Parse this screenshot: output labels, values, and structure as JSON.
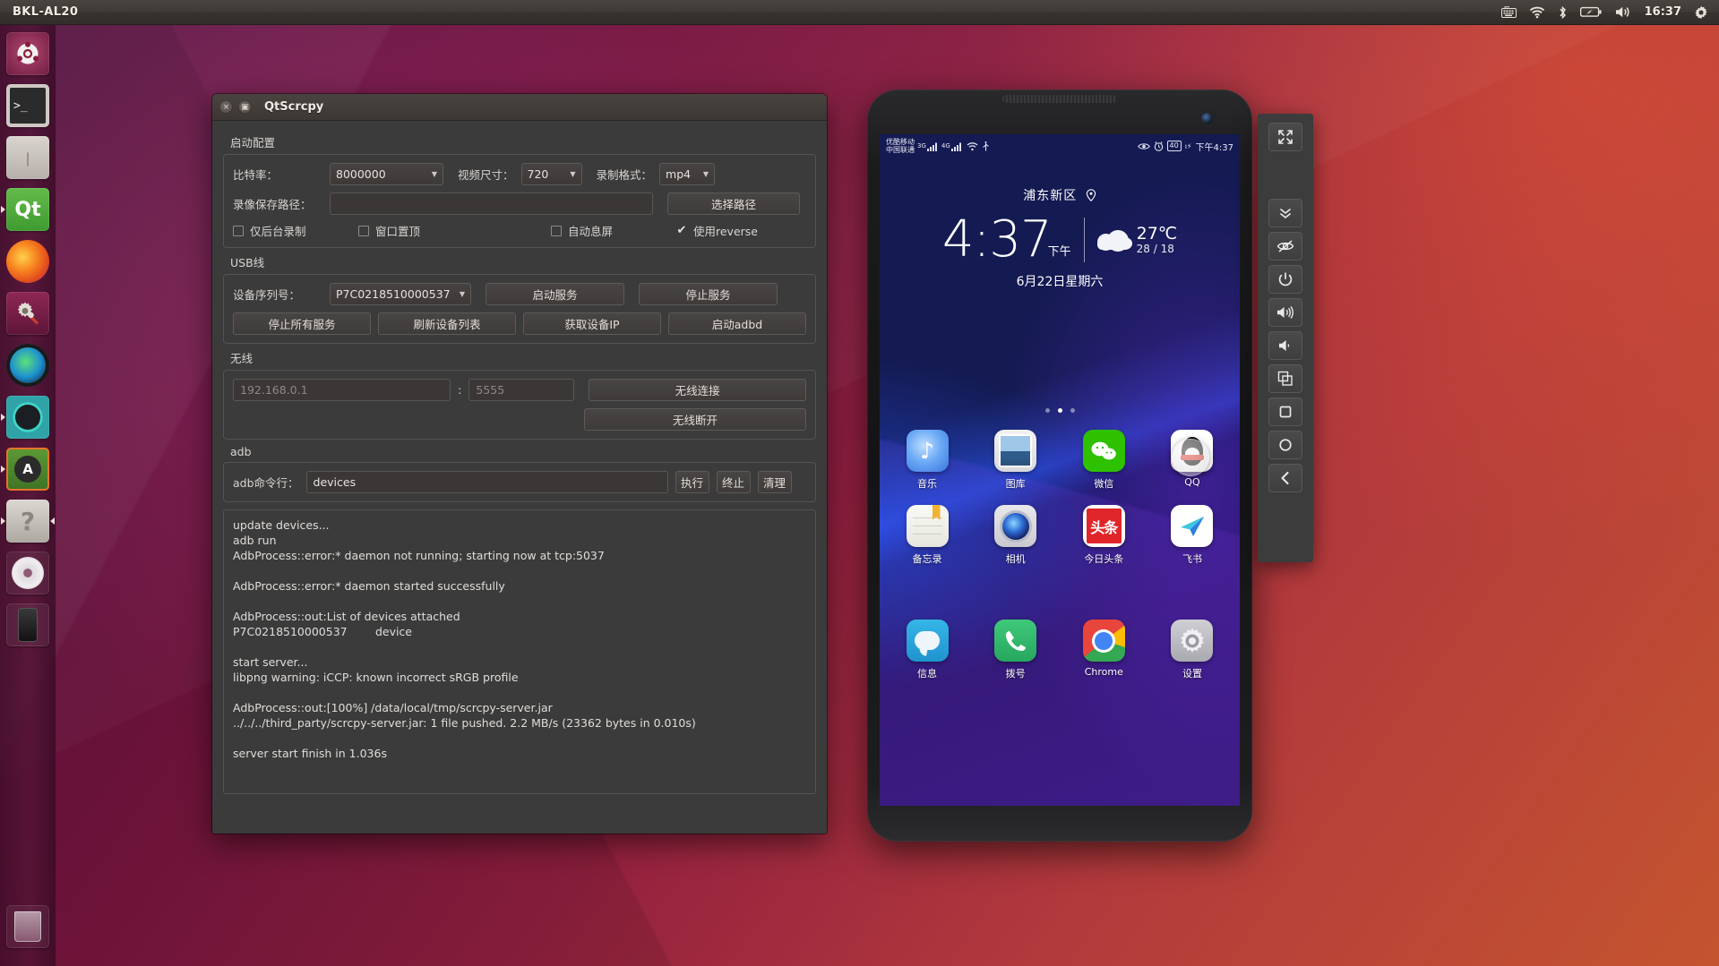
{
  "top_panel": {
    "title": "BKL-AL20",
    "tray": [
      {
        "name": "keyboard-indicator-icon",
        "glyph": "⌨"
      },
      {
        "name": "wifi-icon",
        "glyph": "wifi"
      },
      {
        "name": "bluetooth-icon",
        "glyph": "bt"
      },
      {
        "name": "battery-charging-icon",
        "glyph": "batt"
      },
      {
        "name": "volume-icon",
        "glyph": "vol"
      }
    ],
    "clock": "16:37",
    "session_menu": "gear-icon"
  },
  "launcher": {
    "items": [
      {
        "name": "sidebar-item-ubuntu-dash",
        "label": "Ubuntu Dash",
        "running": false
      },
      {
        "name": "sidebar-item-terminal",
        "label": "Terminal",
        "running": false
      },
      {
        "name": "sidebar-item-files",
        "label": "Files",
        "running": false
      },
      {
        "name": "sidebar-item-qtcreator",
        "label": "Qt Creator",
        "running": true
      },
      {
        "name": "sidebar-item-firefox",
        "label": "Firefox",
        "running": false
      },
      {
        "name": "sidebar-item-tweak-tool",
        "label": "System Tools",
        "running": false
      },
      {
        "name": "sidebar-item-camera-lens",
        "label": "Lens",
        "running": false
      },
      {
        "name": "sidebar-item-krita",
        "label": "Krita",
        "running": true
      },
      {
        "name": "sidebar-item-software-updater",
        "label": "Software Updater",
        "running": true
      },
      {
        "name": "sidebar-item-help",
        "label": "Help",
        "running": true
      },
      {
        "name": "sidebar-item-disc",
        "label": "Disc",
        "running": false
      },
      {
        "name": "sidebar-item-device",
        "label": "Device",
        "running": false
      }
    ],
    "trash": {
      "name": "sidebar-item-trash",
      "label": "Trash"
    }
  },
  "qtscrcpy": {
    "window_title": "QtScrcpy",
    "titlebar": {
      "close": "×",
      "maximize": "▣"
    },
    "groups": {
      "startup": {
        "label": "启动配置",
        "bitrate_label": "比特率：",
        "bitrate_value": "8000000",
        "videosize_label": "视频尺寸：",
        "videosize_value": "720",
        "format_label": "录制格式：",
        "format_value": "mp4",
        "savepath_label": "录像保存路径：",
        "savepath_value": "",
        "choose_path_button": "选择路径",
        "checkboxes": [
          {
            "label": "仅后台录制",
            "checked": false
          },
          {
            "label": "窗口置顶",
            "checked": false
          },
          {
            "label": "自动息屏",
            "checked": false
          },
          {
            "label": "使用reverse",
            "checked": true
          }
        ]
      },
      "usb": {
        "label": "USB线",
        "serial_label": "设备序列号：",
        "serial_value": "P7C0218510000537",
        "buttons_row1": [
          "启动服务",
          "停止服务"
        ],
        "buttons_row2": [
          "停止所有服务",
          "刷新设备列表",
          "获取设备IP",
          "启动adbd"
        ]
      },
      "wireless": {
        "label": "无线",
        "ip_placeholder": "192.168.0.1",
        "colon": ":",
        "port_placeholder": "5555",
        "connect_button": "无线连接",
        "disconnect_button": "无线断开"
      },
      "adb": {
        "label": "adb",
        "cmd_label": "adb命令行：",
        "cmd_value": "devices",
        "run_button": "执行",
        "stop_button": "终止",
        "clear_button": "清理"
      }
    },
    "log": "update devices...\nadb run\nAdbProcess::error:* daemon not running; starting now at tcp:5037\n\nAdbProcess::error:* daemon started successfully\n\nAdbProcess::out:List of devices attached\nP7C0218510000537\tdevice\n\nstart server...\nlibpng warning: iCCP: known incorrect sRGB profile\n\nAdbProcess::out:[100%] /data/local/tmp/scrcpy-server.jar\n../../../third_party/scrcpy-server.jar: 1 file pushed. 2.2 MB/s (23362 bytes in 0.010s)\n\nserver start finish in 1.036s"
  },
  "phone": {
    "status_bar": {
      "carrier_line1": "优酷移动",
      "carrier_line2": "中国联通",
      "net1": "3G",
      "net2": "4G",
      "battery": "40",
      "time": "下午4:37"
    },
    "lock": {
      "location": "浦东新区",
      "location_icon": "pin-icon",
      "time": "4:37",
      "ampm": "下午",
      "temp": "27℃",
      "high_low": "28 / 18",
      "date": "6月22日星期六"
    },
    "apps_row1": [
      {
        "name": "app-icon-music",
        "label": "音乐"
      },
      {
        "name": "app-icon-gallery",
        "label": "图库"
      },
      {
        "name": "app-icon-wechat",
        "label": "微信"
      },
      {
        "name": "app-icon-qq",
        "label": "QQ"
      }
    ],
    "apps_row2": [
      {
        "name": "app-icon-notes",
        "label": "备忘录"
      },
      {
        "name": "app-icon-camera",
        "label": "相机"
      },
      {
        "name": "app-icon-toutiao",
        "label": "今日头条"
      },
      {
        "name": "app-icon-feishu",
        "label": "飞书"
      }
    ],
    "apps_dock": [
      {
        "name": "app-icon-messages",
        "label": "信息"
      },
      {
        "name": "app-icon-dialer",
        "label": "拨号"
      },
      {
        "name": "app-icon-chrome",
        "label": "Chrome"
      },
      {
        "name": "app-icon-settings",
        "label": "设置"
      }
    ],
    "toutiao_text": "头条",
    "page_dots": {
      "count": 3,
      "active": 1
    }
  },
  "toolbar": {
    "buttons": [
      {
        "name": "fullscreen-icon",
        "label": "全屏"
      },
      {
        "name": "expand-notification-icon",
        "label": "展开通知"
      },
      {
        "name": "screen-off-icon",
        "label": "息屏"
      },
      {
        "name": "power-icon",
        "label": "电源"
      },
      {
        "name": "volume-up-icon",
        "label": "音量+"
      },
      {
        "name": "volume-down-icon",
        "label": "音量-"
      },
      {
        "name": "app-switch-icon",
        "label": "多任务"
      },
      {
        "name": "stop-square-icon",
        "label": "停止"
      },
      {
        "name": "home-circle-icon",
        "label": "主页"
      },
      {
        "name": "back-icon",
        "label": "返回"
      }
    ]
  },
  "colors": {
    "accent_orange": "#e8732b",
    "ubuntu_aubergine": "#5a1046",
    "qt_green": "#3f9b31",
    "wechat_green": "#2dc100"
  }
}
